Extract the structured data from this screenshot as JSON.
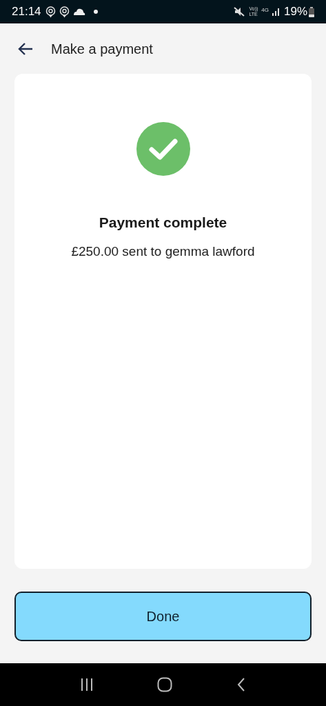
{
  "status_bar": {
    "time": "21:14",
    "volte_top": "Vo))",
    "volte_bottom": "LTE",
    "network": "4G",
    "battery": "19%"
  },
  "header": {
    "title": "Make a payment"
  },
  "result": {
    "title": "Payment complete",
    "message": "£250.00 sent to gemma lawford"
  },
  "buttons": [
    {
      "label": "Done"
    }
  ]
}
